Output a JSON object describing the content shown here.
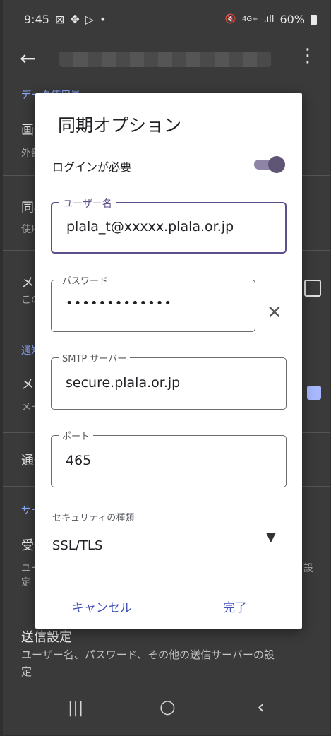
{
  "status_bar": {
    "time": "9:45",
    "left_icons": [
      "⊠",
      "✥",
      "▷",
      "•"
    ],
    "right_icons": [
      "🔇",
      "4G+",
      ".ıll"
    ],
    "battery": "60%"
  },
  "app_bar": {
    "back_icon": "←",
    "menu_icon": "⋮"
  },
  "background": {
    "section_data": "データ使用量",
    "item1_title": "画像",
    "item1_sub": "外部",
    "item2_title": "同期",
    "item2_sub": "使用",
    "item3_title": "メー",
    "item3_sub": "この",
    "section_notify": "通知",
    "item4_title": "メー",
    "item4_sub": "メー",
    "item5_title": "通知",
    "section_server": "サー",
    "item6_title": "受信",
    "item6_sub": "ユー",
    "item6_sub2": "定",
    "item6_right": "設",
    "item7_title": "送信設定",
    "item7_sub": "ユーザー名、パスワード、その他の送信サーバーの設",
    "item7_sub2": "定"
  },
  "dialog": {
    "title": "同期オプション",
    "login_required": "ログインが必要",
    "username_label": "ユーザー名",
    "username_value": "plala_t@xxxxx.plala.or.jp",
    "password_label": "パスワード",
    "password_value": "•••••••••••••",
    "clear_icon": "✕",
    "smtp_label": "SMTP サーバー",
    "smtp_value": "secure.plala.or.jp",
    "port_label": "ポート",
    "port_value": "465",
    "security_label": "セキュリティの種類",
    "security_value": "SSL/TLS",
    "dropdown_icon": "▼",
    "cancel": "キャンセル",
    "done": "完了"
  },
  "nav": {
    "recent": "|||",
    "home": "○",
    "back": "‹"
  }
}
